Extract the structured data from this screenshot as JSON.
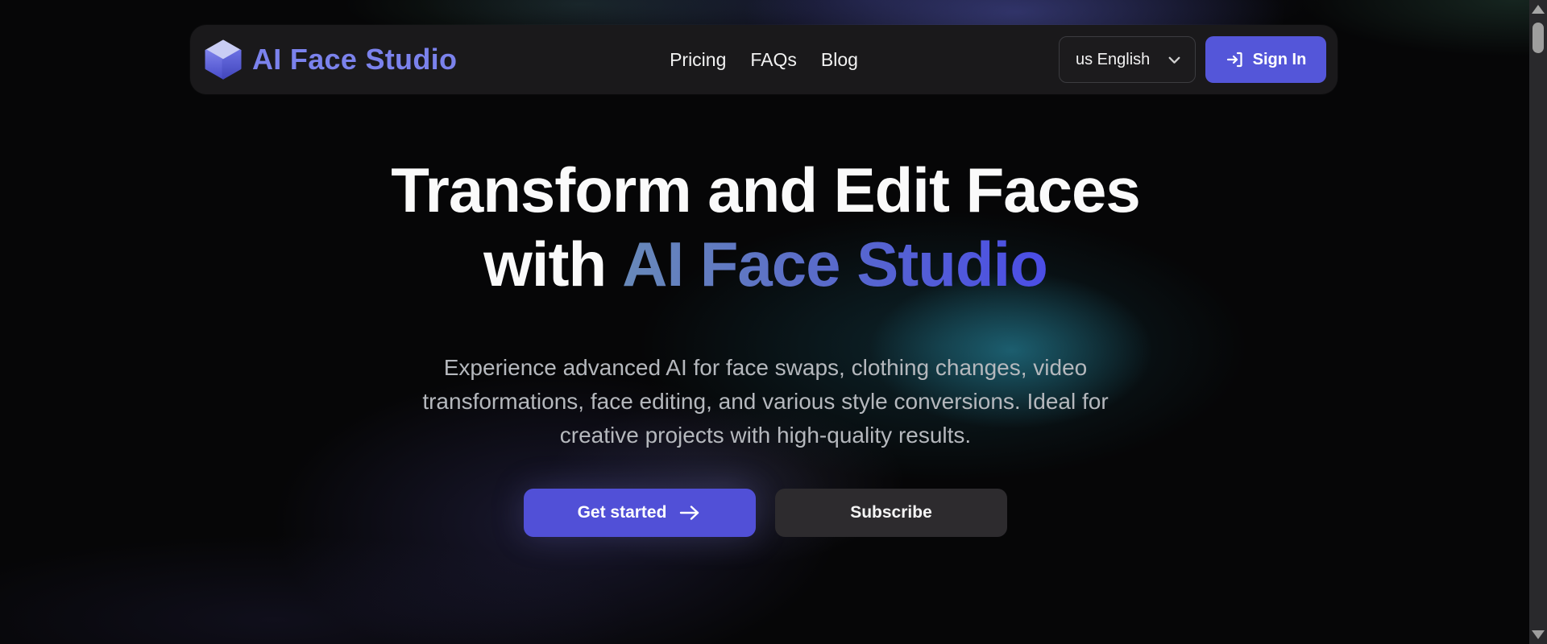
{
  "navbar": {
    "logo": {
      "text": "AI Face Studio"
    },
    "links": [
      {
        "label": "Pricing"
      },
      {
        "label": "FAQs"
      },
      {
        "label": "Blog"
      }
    ],
    "language_selector": {
      "value": "us English"
    },
    "signin_button": {
      "label": "Sign In"
    }
  },
  "hero": {
    "title_line1": "Transform and Edit Faces",
    "title_line2_prefix": "with",
    "title_line2_brand": "AI Face Studio",
    "description": "Experience advanced AI for face swaps, clothing changes, video transformations, face editing, and various style conversions. Ideal for creative projects with high-quality results.",
    "primary_cta": {
      "label": "Get started"
    },
    "secondary_cta": {
      "label": "Subscribe"
    }
  },
  "icons": {
    "logo": "cube-3d",
    "language_chevron": "chevron-down",
    "signin": "login-arrow",
    "primary_cta": "arrow-right",
    "scroll_up": "triangle-up",
    "scroll_down": "triangle-down"
  },
  "colors": {
    "page_bg": "#060607",
    "navbar_bg": "#1a191b",
    "brand_text": "#7b82ec",
    "accent_button": "#5456d9",
    "primary_button": "#5150d7",
    "secondary_button": "#2d2b2e",
    "heading_gradient_start": "#6889b9",
    "heading_gradient_end": "#4b4de6",
    "subtitle_text": "#b5b8bd",
    "teal_glow": "#206e82",
    "purple_glow": "#504ba0"
  }
}
